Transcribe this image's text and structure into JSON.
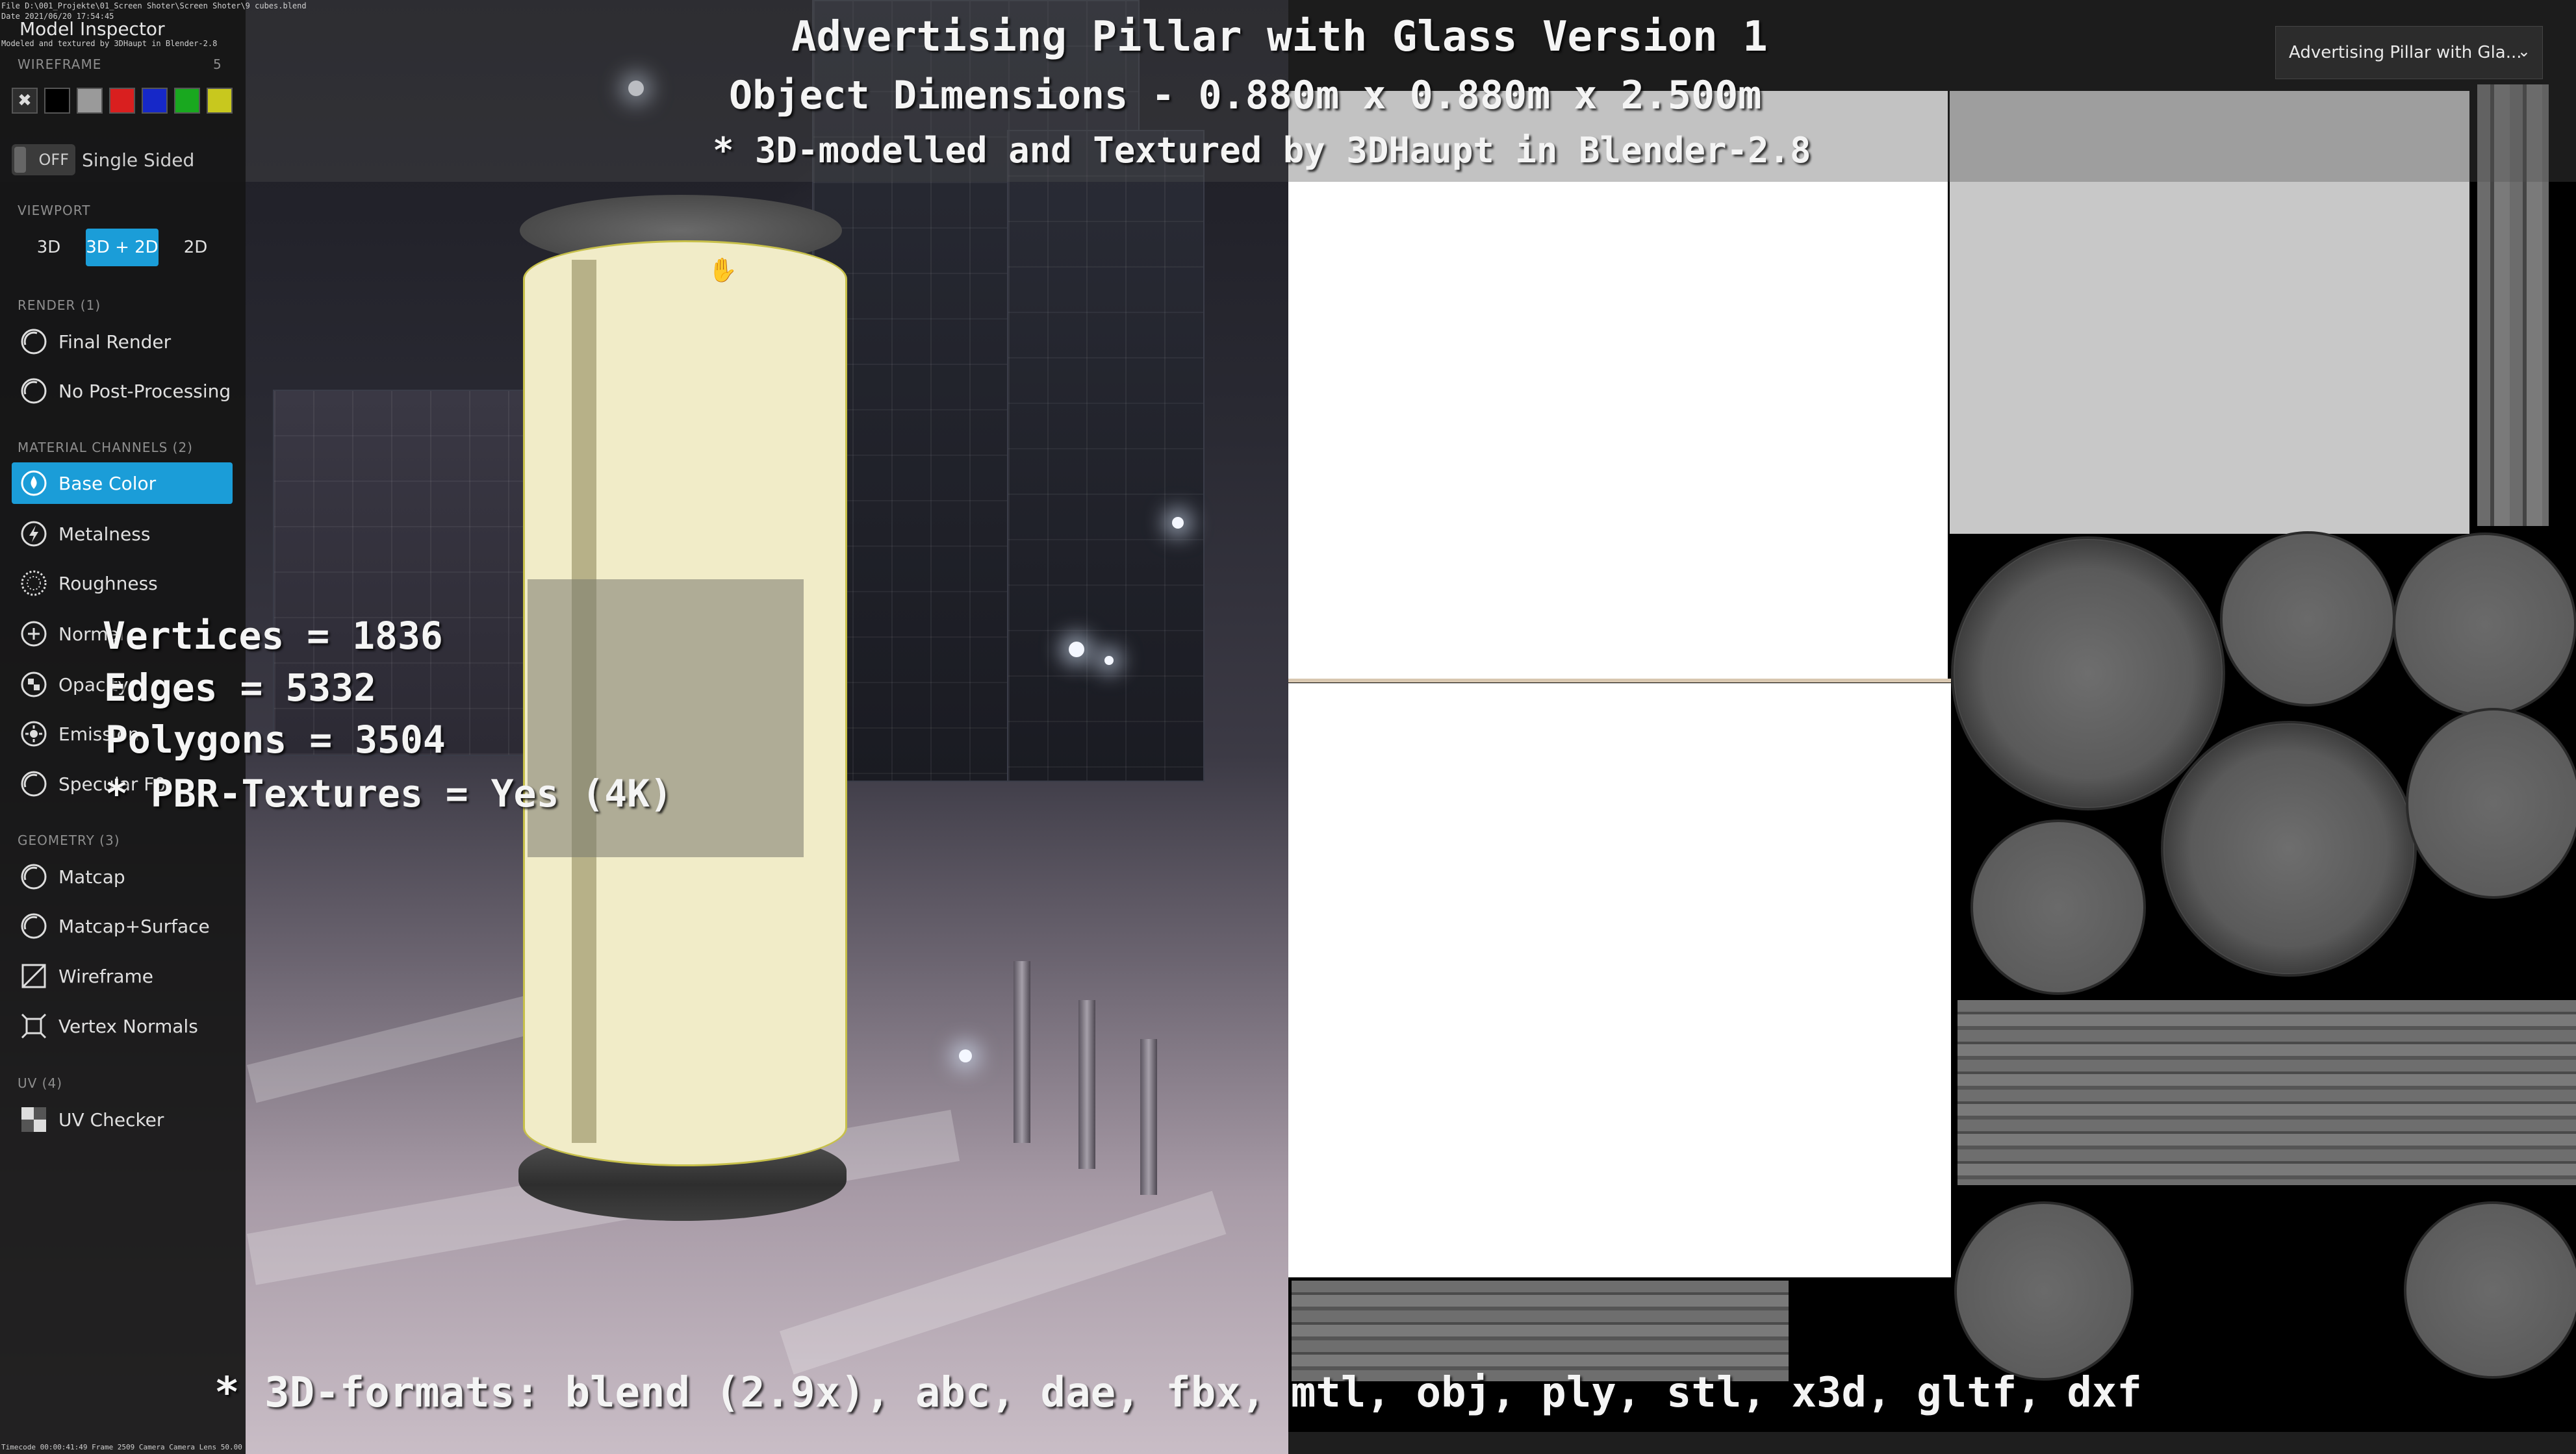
{
  "header_info": {
    "file_line": "File D:\\001_Projekte\\01_Screen Shoter\\Screen Shoter\\9 cubes.blend",
    "date_line": "Date 2021/06/20 17:54:45",
    "app_line": "Model Inspector",
    "credit_line": "Modeled and textured by 3DHaupt in Blender-2.8"
  },
  "overlay": {
    "title": "Advertising Pillar with Glass Version 1",
    "dimensions": "Object Dimensions - 0.880m x 0.880m x 2.500m",
    "credit": "* 3D-modelled and Textured by 3DHaupt in Blender-2.8",
    "vertices": "Vertices = 1836",
    "edges": "Edges = 5332",
    "polygons": "Polygons = 3504",
    "pbr": "* PBR-Textures =  Yes (4K)",
    "formats": "* 3D-formats: blend (2.9x), abc, dae, fbx, mtl, obj, ply, stl, x3d, gltf, dxf"
  },
  "sidebar": {
    "wireframe_label": "WIREFRAME",
    "wireframe_value": "5",
    "swatches": [
      "#2e2e2e",
      "#000000",
      "#9a9a9a",
      "#d91f1f",
      "#1628c8",
      "#19a81f",
      "#c8c81e"
    ],
    "single_sided_toggle": "OFF",
    "single_sided_label": "Single Sided",
    "viewport_label": "VIEWPORT",
    "viewport_buttons": [
      "3D",
      "3D + 2D",
      "2D"
    ],
    "render_label": "RENDER (1)",
    "render_items": [
      "Final Render",
      "No Post-Processing"
    ],
    "material_label": "MATERIAL CHANNELS (2)",
    "material_items": [
      "Base Color",
      "Metalness",
      "Roughness",
      "Normal",
      "Opacity",
      "Emission",
      "Specular F0"
    ],
    "geometry_label": "GEOMETRY (3)",
    "geometry_items": [
      "Matcap",
      "Matcap+Surface",
      "Wireframe",
      "Vertex Normals"
    ],
    "uv_label": "UV (4)",
    "uv_items": [
      "UV Checker"
    ]
  },
  "dropdown": {
    "value": "Advertising Pillar with Gla..."
  },
  "status_bar": "Timecode 00:00:41:49   Frame 2509   Camera Camera   Lens 50.00",
  "colors": {
    "accent": "#1b9dd8",
    "glass": "#f1ecc8",
    "outline": "#c7c04a"
  }
}
